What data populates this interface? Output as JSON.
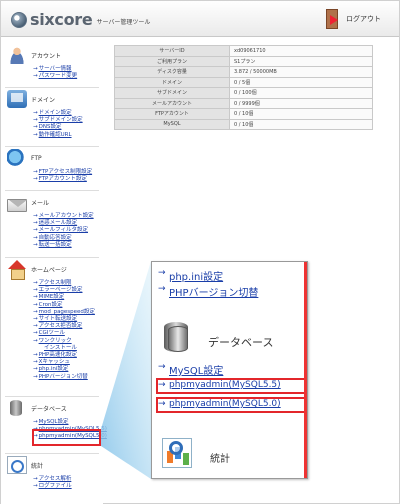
{
  "header": {
    "logo_text": "sixcore",
    "logo_sub": "サーバー管理ツール",
    "logout_label": "ログアウト",
    "logout_icon": "door-exit-icon"
  },
  "sidebar": {
    "account": {
      "title": "アカウント",
      "icon": "account-icon",
      "links": [
        "サーバー情報",
        "パスワード変更"
      ]
    },
    "domain": {
      "title": "ドメイン",
      "icon": "domain-icon",
      "links": [
        "ドメイン設定",
        "サブドメイン設定",
        "DNS設定",
        "動作確認URL"
      ]
    },
    "ftp": {
      "title": "FTP",
      "icon": "ftp-globe-icon",
      "links": [
        "FTPアクセス制限設定",
        "FTPアカウント設定"
      ]
    },
    "mail": {
      "title": "メール",
      "icon": "mail-icon",
      "links": [
        "メールアカウント設定",
        "迷惑メール設定",
        "メールフィルタ設定",
        "自動応答設定",
        "転送一括設定"
      ]
    },
    "homepage": {
      "title": "ホームページ",
      "icon": "home-icon",
      "links": [
        "アクセス制限",
        "エラーページ設定",
        "MIME設定",
        "Cron設定",
        "mod_pagespeed設定",
        "サイト転送設定",
        "アクセス拒否設定",
        "CGIツール"
      ],
      "cgi_sub": "インストール",
      "links2": [
        "PHP高速化設定",
        "Xキャッシュ",
        "php.ini設定",
        "PHPバージョン切替"
      ]
    },
    "database": {
      "title": "データベース",
      "icon": "database-icon",
      "links": [
        "MySQL設定",
        "phpmyadmin(MySQL5.5)",
        "phpmyadmin(MySQL5.0)"
      ]
    },
    "stats": {
      "title": "統計",
      "icon": "stats-icon",
      "links": [
        "アクセス解析",
        "ログファイル"
      ]
    }
  },
  "info_table": [
    {
      "key": "サーバーID",
      "value": "xd09061710"
    },
    {
      "key": "ご利用プラン",
      "value": "S1プラン"
    },
    {
      "key": "ディスク容量",
      "value": "3.872 / 50000MB"
    },
    {
      "key": "ドメイン",
      "value": "0 / 5個"
    },
    {
      "key": "サブドメイン",
      "value": "0 / 100個"
    },
    {
      "key": "メールアカウント",
      "value": "0 / 9999個"
    },
    {
      "key": "FTPアカウント",
      "value": "0 / 10個"
    },
    {
      "key": "MySQL",
      "value": "0 / 10個"
    }
  ],
  "zoom": {
    "php_ini": "php.ini設定",
    "php_version": "PHPバージョン切替",
    "db_title": "データベース",
    "mysql": "MySQL設定",
    "pma55": "phpmyadmin(MySQL5.5)",
    "pma50": "phpmyadmin(MySQL5.0)",
    "stats": "統計"
  },
  "colors": {
    "highlight": "#e3262b",
    "link": "#1a3ea8",
    "accent_wedge": "#7fc0e8"
  }
}
